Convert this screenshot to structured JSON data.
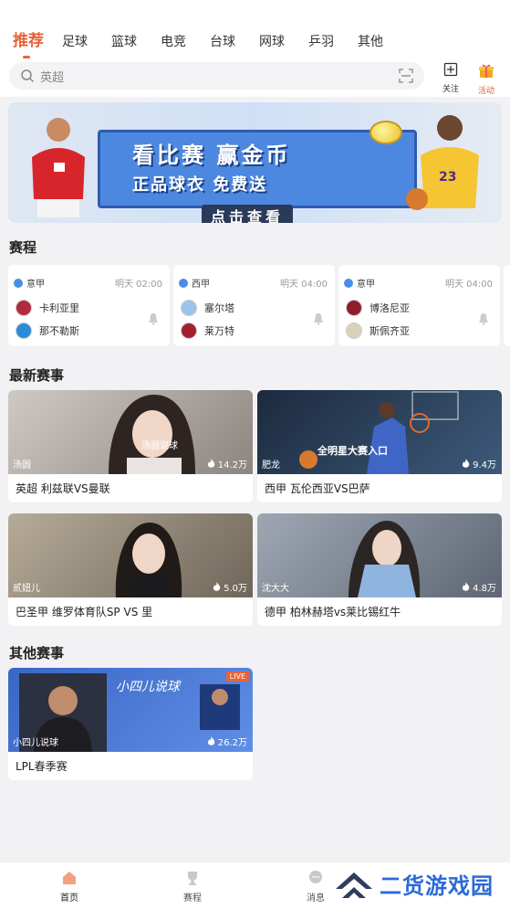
{
  "tabs": [
    "推荐",
    "足球",
    "篮球",
    "电竞",
    "台球",
    "网球",
    "乒羽",
    "其他"
  ],
  "search": {
    "placeholder": "英超"
  },
  "header_actions": {
    "follow": "关注",
    "activity": "活动"
  },
  "banner": {
    "line1": "看比赛 赢金币",
    "line2": "正品球衣    免费送",
    "cta": "点击查看"
  },
  "schedule": {
    "title": "赛程",
    "cards": [
      {
        "league": "意甲",
        "time": "明天 02:00",
        "home": "卡利亚里",
        "away": "那不勒斯"
      },
      {
        "league": "西甲",
        "time": "明天 04:00",
        "home": "塞尔塔",
        "away": "莱万特"
      },
      {
        "league": "意甲",
        "time": "明天 04:00",
        "home": "博洛尼亚",
        "away": "斯佩齐亚"
      }
    ]
  },
  "latest": {
    "title": "最新赛事",
    "items": [
      {
        "host": "汤圆",
        "heat": "14.2万",
        "caption": "英超 利兹联VS曼联",
        "overlay": "汤圆说球"
      },
      {
        "host": "肥龙",
        "heat": "9.4万",
        "caption": "西甲 瓦伦西亚VS巴萨",
        "overlay": "全明星大赛入口"
      },
      {
        "host": "贰妞儿",
        "heat": "5.0万",
        "caption": "巴圣甲 维罗体育队SP VS 里",
        "overlay": ""
      },
      {
        "host": "沈大大",
        "heat": "4.8万",
        "caption": "德甲 柏林赫塔vs莱比锡红牛",
        "overlay": ""
      }
    ]
  },
  "other": {
    "title": "其他赛事",
    "items": [
      {
        "host": "小四儿说球",
        "heat": "26.2万",
        "caption": "LPL春季赛",
        "overlay": "小四儿说球",
        "live": "LIVE"
      }
    ]
  },
  "bottom_nav": [
    {
      "label": "首页",
      "icon": "home-icon"
    },
    {
      "label": "赛程",
      "icon": "trophy-icon"
    },
    {
      "label": "消息",
      "icon": "chat-icon"
    }
  ],
  "watermark": "二货游戏园",
  "colors": {
    "accent": "#e8633a",
    "watermark": "#2c6ad8"
  }
}
